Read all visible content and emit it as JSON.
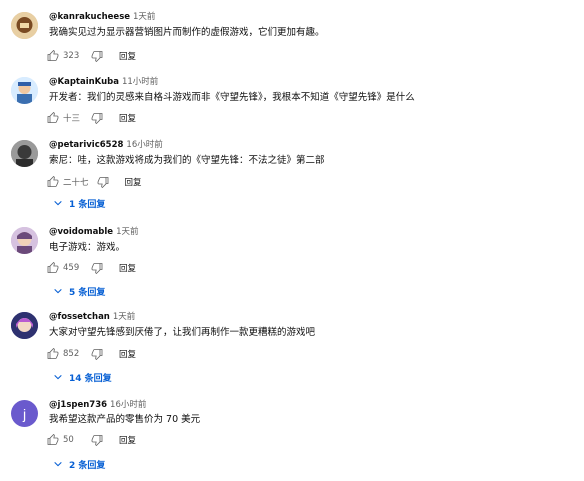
{
  "comments": [
    {
      "handle": "@kanrakucheese",
      "time": "1天前",
      "text": "我确实见过为显示器营销图片而制作的虚假游戏，它们更加有趣。",
      "likes": "323",
      "reply_label": "回复",
      "avatar_color": "#7a4a22"
    },
    {
      "handle": "@KaptainKuba",
      "time": "11小时前",
      "text": "开发者：我们的灵感来自格斗游戏而非《守望先锋》，我根本不知道《守望先锋》是什么",
      "likes": "十三",
      "reply_label": "回复",
      "avatar_color": "#3b6fb0"
    },
    {
      "handle": "@petarivic6528",
      "time": "16小时前",
      "text": "索尼：哇，这款游戏将成为我们的《守望先锋：不法之徒》第二部",
      "likes": "二十七",
      "reply_label": "回复",
      "replies": "1 条回复",
      "avatar_color": "#4a4a4a"
    },
    {
      "handle": "@voidomable",
      "time": "1天前",
      "text": "电子游戏：游戏。",
      "likes": "459",
      "reply_label": "回复",
      "replies": "5 条回复",
      "avatar_color": "#6b4a7a"
    },
    {
      "handle": "@fossetchan",
      "time": "1天前",
      "text": "大家对守望先锋感到厌倦了，让我们再制作一款更糟糕的游戏吧",
      "likes": "852",
      "reply_label": "回复",
      "replies": "14 条回复",
      "avatar_color": "#3b3f8a"
    },
    {
      "handle": "@j1spen736",
      "time": "16小时前",
      "text": "我希望这款产品的零售价为 70 美元",
      "likes": "50",
      "reply_label": "回复",
      "replies": "2 条回复",
      "avatar_letter": "j",
      "avatar_color": "#6a5acd"
    }
  ]
}
